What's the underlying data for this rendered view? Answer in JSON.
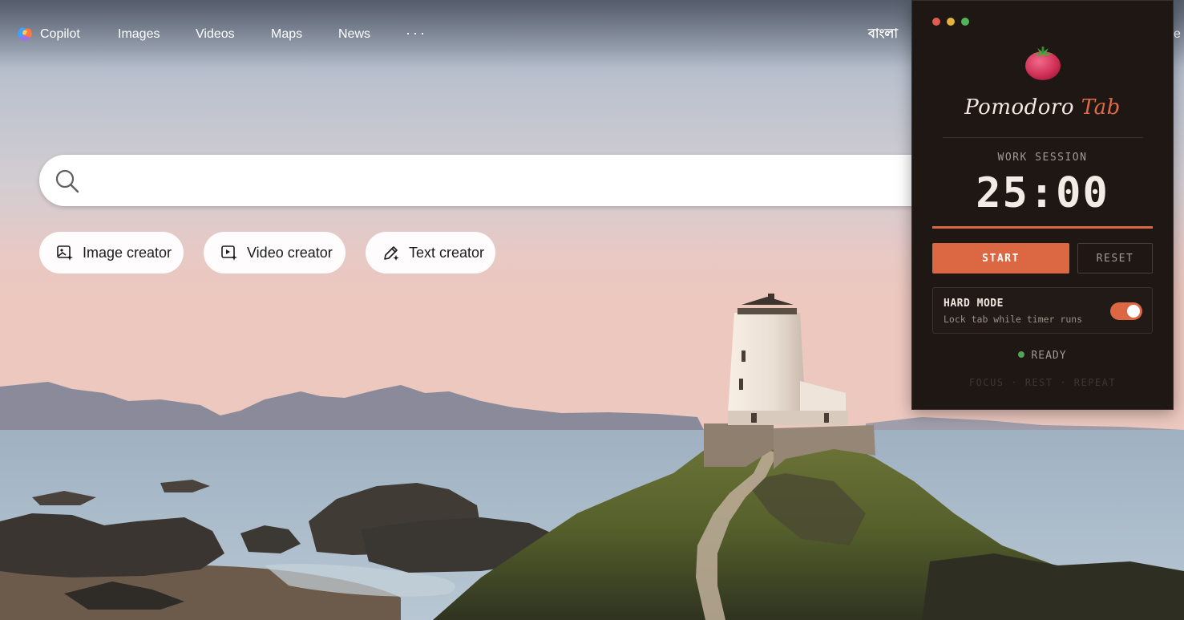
{
  "nav": {
    "items": [
      {
        "label": "Copilot"
      },
      {
        "label": "Images"
      },
      {
        "label": "Videos"
      },
      {
        "label": "Maps"
      },
      {
        "label": "News"
      }
    ],
    "more": "···",
    "language": "বাংলা",
    "right_cutoff_text": "e"
  },
  "search": {
    "value": "",
    "placeholder": ""
  },
  "creators": [
    {
      "label": "Image creator",
      "icon": "image-sparkle-icon"
    },
    {
      "label": "Video creator",
      "icon": "video-sparkle-icon"
    },
    {
      "label": "Text creator",
      "icon": "pen-sparkle-icon"
    }
  ],
  "pomodoro": {
    "title_main": "Pomodoro",
    "title_accent": "Tab",
    "session_label": "WORK SESSION",
    "time": "25:00",
    "progress_fraction": 1.0,
    "start_label": "START",
    "reset_label": "RESET",
    "hard_mode": {
      "title": "HARD MODE",
      "subtitle": "Lock tab while timer runs",
      "enabled": true
    },
    "status": "READY",
    "footer": "FOCUS · REST · REPEAT",
    "colors": {
      "accent": "#db6843",
      "panel": "#1e1714",
      "ready": "#4fa35a"
    },
    "window_dots": [
      "#e05d4f",
      "#e3b33c",
      "#4fb45a"
    ]
  }
}
